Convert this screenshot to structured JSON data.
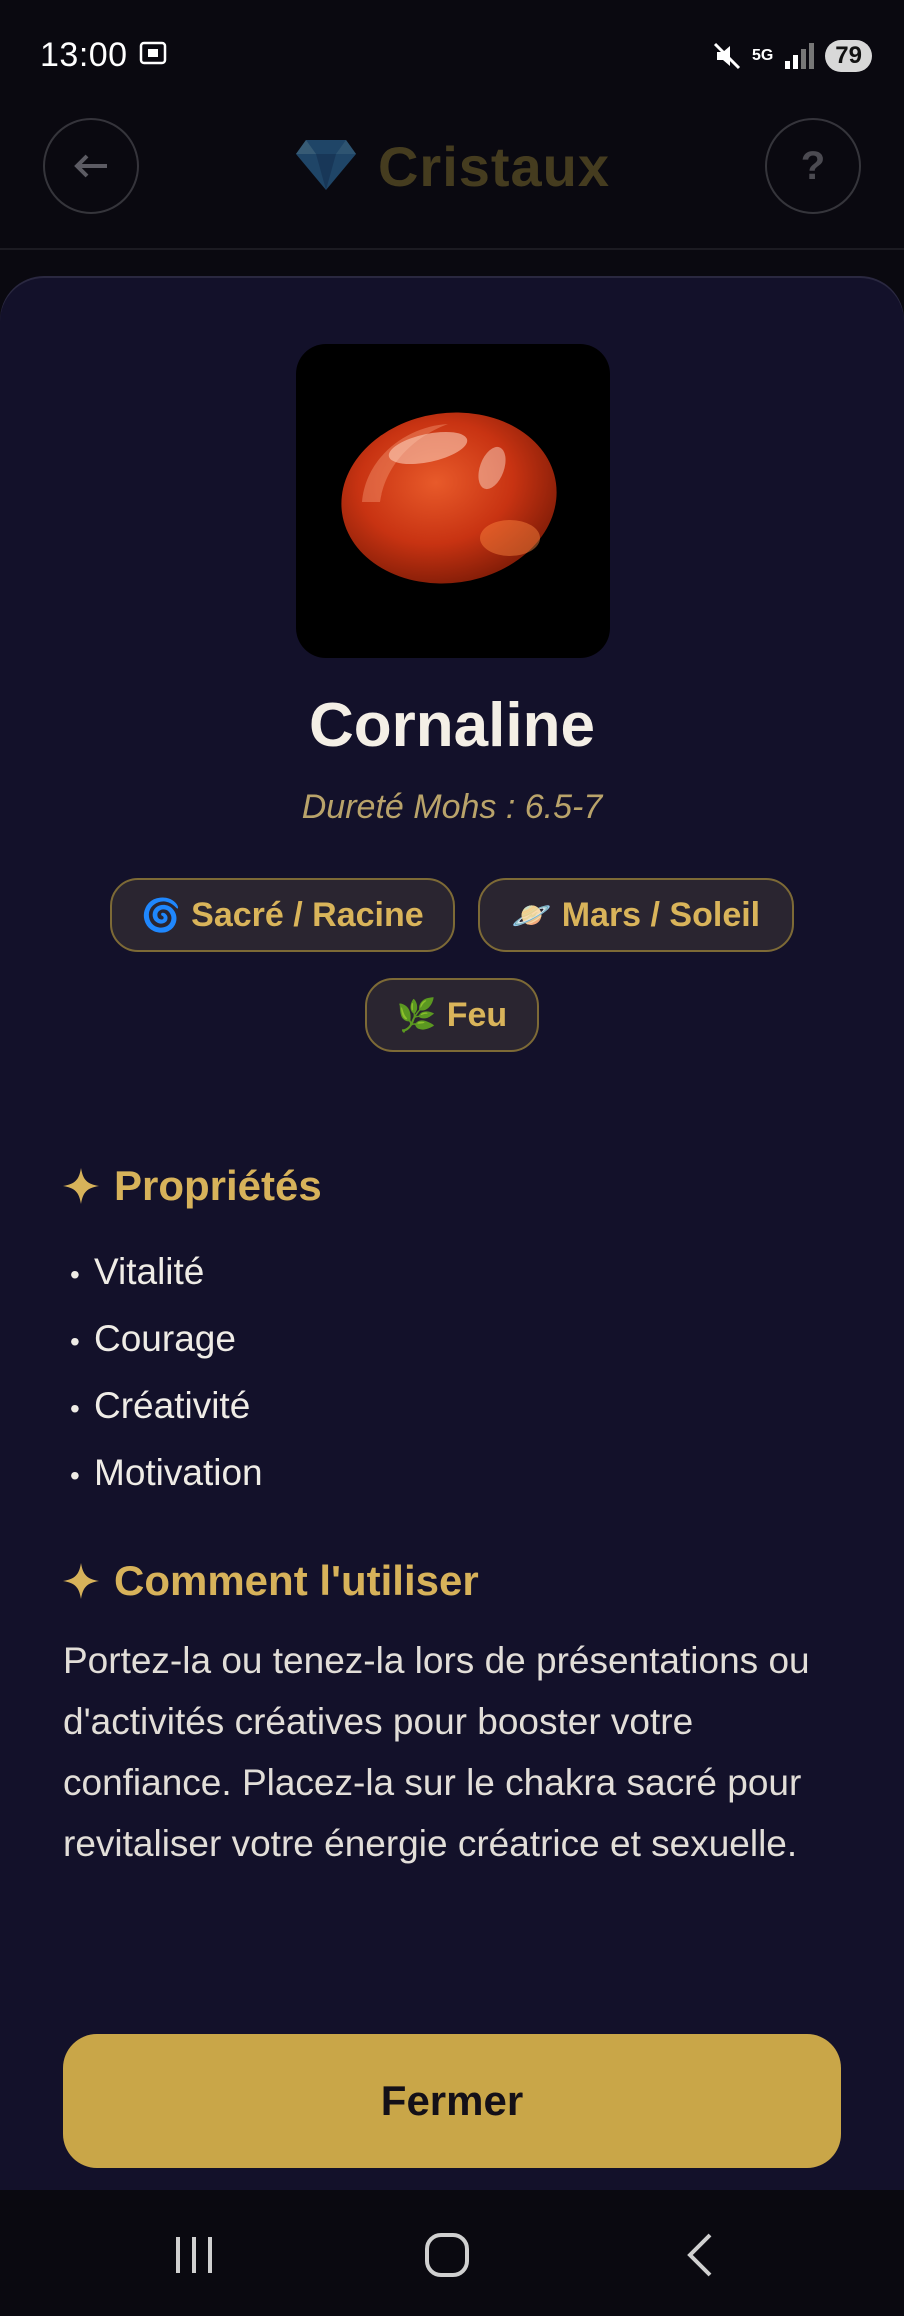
{
  "status_bar": {
    "time": "13:00",
    "network": "5G",
    "battery": "79"
  },
  "header": {
    "title": "Cristaux",
    "back_icon": "arrow-left-icon",
    "help_label": "?"
  },
  "crystal": {
    "name": "Cornaline",
    "hardness": "Dureté Mohs : 6.5-7",
    "tags": [
      {
        "emoji": "🌀",
        "label": "Sacré / Racine"
      },
      {
        "emoji": "🪐",
        "label": "Mars / Soleil"
      },
      {
        "emoji": "🌿",
        "label": "Feu"
      }
    ]
  },
  "properties": {
    "title": "Propriétés",
    "items": [
      "Vitalité",
      "Courage",
      "Créativité",
      "Motivation"
    ]
  },
  "usage": {
    "title": "Comment l'utiliser",
    "text": "Portez-la ou tenez-la lors de présentations ou d'activités créatives pour booster votre confiance. Placez-la sur le chakra sacré pour revitaliser votre énergie créatrice et sexuelle."
  },
  "close_button": "Fermer",
  "colors": {
    "accent_gold": "#c9a648",
    "sheet_bg": "#13112a",
    "page_bg": "#0a0910"
  }
}
